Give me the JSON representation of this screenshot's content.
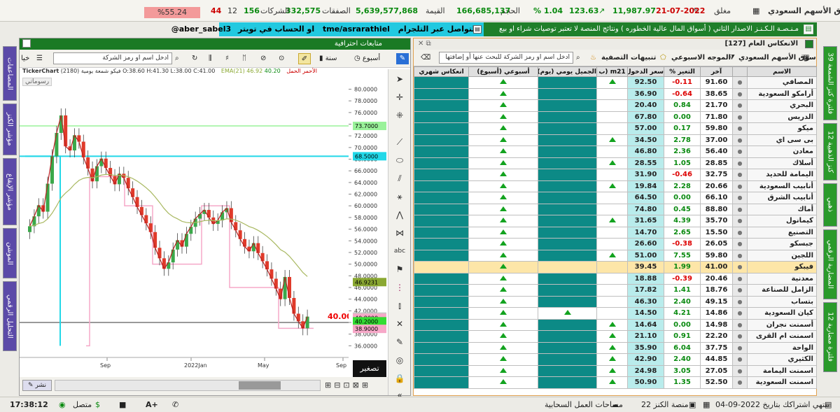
{
  "top": {
    "market": "سوق الأسهم السعودي",
    "status": "مغلق",
    "date": "21-07-2022",
    "index": "11,987.97",
    "change": "123.63",
    "change_pct": "1.04 %",
    "volume_label": "الحجم",
    "volume": "166,685,137",
    "value_label": "القيمة",
    "value": "5,639,577,868",
    "deals_label": "الصفقات",
    "deals": "332,575",
    "companies_label": "الشركات",
    "up": "156",
    "unch": "12",
    "down": "44",
    "pct": "%55.24"
  },
  "ticker": {
    "text": "مـنـصـة الـكـنـز الاصدار الثاني ( أسواق المال عالية الخطوره ) ونتائج المنصة لا تعتبر توصيات شراء او بيع",
    "telegram_prefix": "للتواصل عبر التلجرام",
    "telegram": "tme/asrarathiel",
    "twitter_prefix": "او الحساب في تويتر",
    "twitter": "aber_sabel3@"
  },
  "left_tabs": [
    "المضاعفات",
    "مؤشر الكنز",
    "مؤشر الإيقاع",
    "الموشن",
    "التحليل الرقمي"
  ],
  "right_tabs": [
    "فلترة كنز الشمعة 39",
    "كنز الذهبية 12",
    "ذهبي",
    "المضاربة الرقمي",
    "فلترة مضاربة 12"
  ],
  "chart_panel": {
    "title": "متابعات احترافية",
    "week": "أسبوع",
    "year": "سنة",
    "search_placeholder": "ادخل اسم او رمز الشركة",
    "chart_name": "TickerChart",
    "info": "(2180) فيكو شمعة يومية  O:38.60  H:41.30  L:38.00  C:41.00",
    "ema_label": "EMA(21)",
    "ema_value": "46.92",
    "red_label": "الأحمر الحمل",
    "red_value": "40.20",
    "draw_label": "رسوماتي",
    "shrink": "تصغير",
    "publish": "نشر"
  },
  "chart_data": {
    "type": "candlestick",
    "x_ticks": [
      "Sep",
      "2022Jan",
      "May",
      "Sep"
    ],
    "y_ticks": [
      "80.0000",
      "78.0000",
      "76.0000",
      "74.0000",
      "72.0000",
      "70.0000",
      "68.0000",
      "66.0000",
      "64.0000",
      "62.0000",
      "60.0000",
      "58.0000",
      "56.0000",
      "54.0000",
      "52.0000",
      "50.0000",
      "48.0000",
      "46.0000",
      "44.0000",
      "42.0000",
      "40.0000",
      "38.0000",
      "36.0000"
    ],
    "ylim": [
      34,
      81.5
    ],
    "markers": [
      {
        "label": "73.7000",
        "value": 73.7,
        "color": "#9af29a"
      },
      {
        "label": "68.5000",
        "value": 68.5,
        "color": "#22d8e8"
      },
      {
        "label": "46.9231",
        "value": 46.92,
        "color": "#8aa832"
      },
      {
        "label": "41.0000",
        "value": 41.0,
        "color": "#c8c8c8"
      },
      {
        "label": "40.8000",
        "value": 40.8,
        "color": "#f7a8c8"
      },
      {
        "label": "40.2000",
        "value": 40.2,
        "color": "#33dd33"
      },
      {
        "label": "38.9000",
        "value": 38.9,
        "color": "#f7a8c8"
      }
    ],
    "last_price": "40.00",
    "last_value": 40.0,
    "closes": [
      56.5,
      58.2,
      60.1,
      59.0,
      63.8,
      68.5,
      72.5,
      75.5,
      70.2,
      69.5,
      72.1,
      71.0,
      68.3,
      66.4,
      64.2,
      66.8,
      68.1,
      66.5,
      65.1,
      63.7,
      65.5,
      64.8,
      63.0,
      61.5,
      59.8,
      58.4,
      57.0,
      55.5,
      52.8,
      51.0,
      49.2,
      50.3,
      52.5,
      54.1,
      53.0,
      55.2,
      56.4,
      57.8,
      58.6,
      59.3,
      58.0,
      56.9,
      57.5,
      58.9,
      59.6,
      57.2,
      55.8,
      54.3,
      53.0,
      52.2,
      53.6,
      51.9,
      50.5,
      49.1,
      47.5,
      45.8,
      44.0,
      47.8,
      44.2,
      41.5,
      40.2,
      39.0,
      41.0
    ]
  },
  "screener": {
    "title": "الانعكاس العام [127]",
    "market": "سوق الأسهم السعودي",
    "weekly_wave": "الموجه الاسبوعي",
    "alerts": "تنبيهات التصفية",
    "search_placeholder": "ادخل اسم او رمز الشركة للبحث عنها أو إضافتها",
    "columns": [
      "الاسم",
      "آخر",
      "التغير %",
      "سعر الدخول",
      "m21 (ب",
      "الجميل يومي (يوم)",
      "أسبوعي (أسبوع)",
      "انعكاس شهري"
    ],
    "rows": [
      {
        "name": "المصافي",
        "last": "91.60",
        "chg": "0.11-",
        "neg": true,
        "entry": "92.50",
        "m21": true,
        "daily": false,
        "wk": true
      },
      {
        "name": "أرامكو السعودية",
        "last": "38.65",
        "chg": "0.64-",
        "neg": true,
        "entry": "36.90",
        "m21": false,
        "daily": false,
        "wk": true
      },
      {
        "name": "البحري",
        "last": "21.70",
        "chg": "0.84",
        "neg": false,
        "entry": "20.40",
        "m21": false,
        "daily": false,
        "wk": true
      },
      {
        "name": "الدريس",
        "last": "71.80",
        "chg": "0.00",
        "neg": false,
        "entry": "67.80",
        "m21": false,
        "daily": false,
        "wk": true
      },
      {
        "name": "ميكو",
        "last": "59.80",
        "chg": "0.17",
        "neg": false,
        "entry": "57.00",
        "m21": false,
        "daily": false,
        "wk": true
      },
      {
        "name": "بى سى اي",
        "last": "37.00",
        "chg": "2.78",
        "neg": false,
        "entry": "34.50",
        "m21": true,
        "daily": false,
        "wk": true
      },
      {
        "name": "معادن",
        "last": "56.40",
        "chg": "2.36",
        "neg": false,
        "entry": "46.80",
        "m21": false,
        "daily": false,
        "wk": true
      },
      {
        "name": "أسلاك",
        "last": "28.85",
        "chg": "1.05",
        "neg": false,
        "entry": "28.55",
        "m21": true,
        "daily": false,
        "wk": true
      },
      {
        "name": "اليمامة للحديد",
        "last": "32.75",
        "chg": "0.46-",
        "neg": true,
        "entry": "31.90",
        "m21": false,
        "daily": false,
        "wk": true
      },
      {
        "name": "أنابيب السعودية",
        "last": "20.66",
        "chg": "2.28",
        "neg": false,
        "entry": "19.84",
        "m21": true,
        "daily": false,
        "wk": true
      },
      {
        "name": "أنابيب الشرق",
        "last": "66.10",
        "chg": "0.00",
        "neg": false,
        "entry": "64.50",
        "m21": false,
        "daily": false,
        "wk": true
      },
      {
        "name": "أماك",
        "last": "88.80",
        "chg": "0.45",
        "neg": false,
        "entry": "74.80",
        "m21": false,
        "daily": false,
        "wk": true
      },
      {
        "name": "كيمانول",
        "last": "35.70",
        "chg": "4.39",
        "neg": false,
        "entry": "31.65",
        "m21": true,
        "daily": false,
        "wk": true
      },
      {
        "name": "التصنيع",
        "last": "15.50",
        "chg": "2.65",
        "neg": false,
        "entry": "14.70",
        "m21": false,
        "daily": false,
        "wk": true
      },
      {
        "name": "جبسكو",
        "last": "26.05",
        "chg": "0.38-",
        "neg": true,
        "entry": "26.60",
        "m21": false,
        "daily": false,
        "wk": true
      },
      {
        "name": "اللجين",
        "last": "59.80",
        "chg": "7.55",
        "neg": false,
        "entry": "51.00",
        "m21": true,
        "daily": false,
        "wk": true
      },
      {
        "name": "فيبكو",
        "last": "41.00",
        "chg": "1.99",
        "neg": false,
        "entry": "39.45",
        "m21": false,
        "daily": false,
        "wk": true,
        "hl": true
      },
      {
        "name": "معدنية",
        "last": "20.46",
        "chg": "0.39-",
        "neg": true,
        "entry": "18.88",
        "m21": false,
        "daily": false,
        "wk": true
      },
      {
        "name": "الزامل للصناعة",
        "last": "18.76",
        "chg": "1.41",
        "neg": false,
        "entry": "17.82",
        "m21": false,
        "daily": false,
        "wk": true
      },
      {
        "name": "بتساب",
        "last": "49.15",
        "chg": "2.40",
        "neg": false,
        "entry": "46.30",
        "m21": false,
        "daily": false,
        "wk": true
      },
      {
        "name": "كيان السعودية",
        "last": "14.86",
        "chg": "4.21",
        "neg": false,
        "entry": "14.50",
        "m21": false,
        "daily": true,
        "wk": true
      },
      {
        "name": "أسمنت نجران",
        "last": "14.98",
        "chg": "0.00",
        "neg": false,
        "entry": "14.64",
        "m21": true,
        "daily": false,
        "wk": true
      },
      {
        "name": "اسمنت ام القرى",
        "last": "22.20",
        "chg": "0.91",
        "neg": false,
        "entry": "21.10",
        "m21": true,
        "daily": false,
        "wk": true
      },
      {
        "name": "الواحة",
        "last": "37.75",
        "chg": "6.04",
        "neg": false,
        "entry": "35.90",
        "m21": true,
        "daily": false,
        "wk": true
      },
      {
        "name": "الكثيري",
        "last": "44.85",
        "chg": "2.40",
        "neg": false,
        "entry": "42.90",
        "m21": true,
        "daily": false,
        "wk": true
      },
      {
        "name": "اسمنت اليمامة",
        "last": "27.05",
        "chg": "3.05",
        "neg": false,
        "entry": "24.98",
        "m21": true,
        "daily": false,
        "wk": true
      },
      {
        "name": "اسمنت السعودية",
        "last": "52.50",
        "chg": "1.35",
        "neg": false,
        "entry": "50.90",
        "m21": true,
        "daily": false,
        "wk": true
      }
    ]
  },
  "status": {
    "time": "17:38:12",
    "connected": "متصل",
    "subscription": "ينتهي اشتراكك بتاريخ 2022-09-04",
    "platform": "منصة الكنز 22",
    "cloud": "مساحات العمل السحابية"
  }
}
